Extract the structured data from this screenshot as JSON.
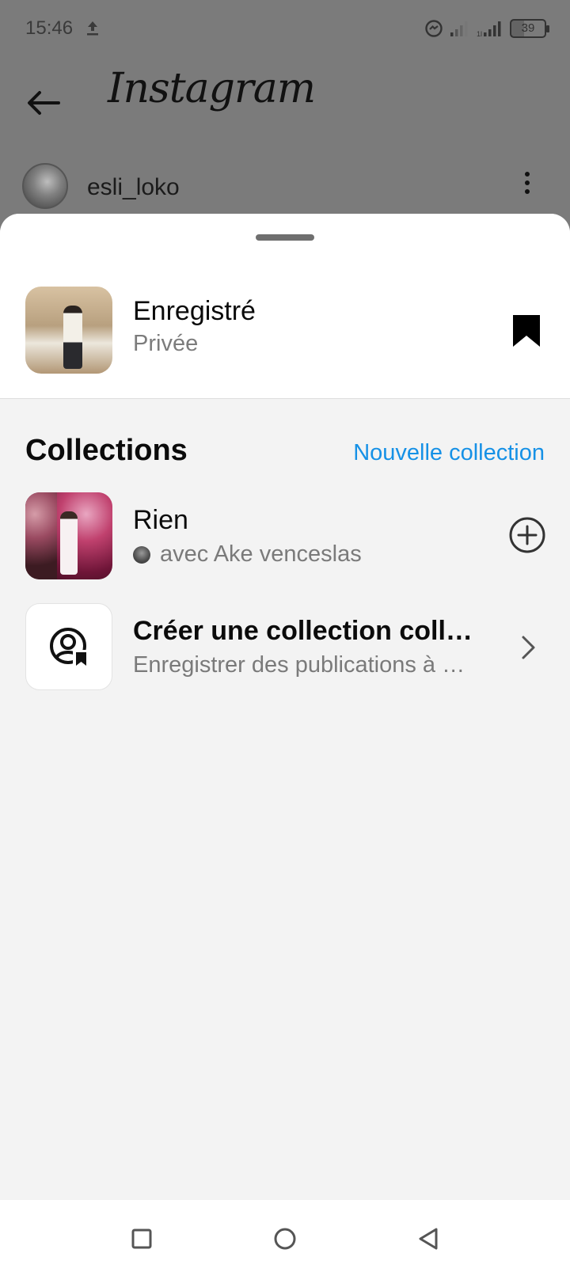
{
  "status_bar": {
    "time": "15:46",
    "battery": "39",
    "icons": [
      "upload-icon",
      "messenger-bubble-icon",
      "signal-icon",
      "signal-icon",
      "battery-icon"
    ]
  },
  "header": {
    "app_name": "Instagram",
    "back_icon": "arrow-left-icon"
  },
  "post": {
    "username": "esli_loko",
    "more_icon": "vertical-dots-icon"
  },
  "sheet": {
    "saved": {
      "title": "Enregistré",
      "privacy": "Privée",
      "icon": "bookmark-filled-icon"
    },
    "collections": {
      "title": "Collections",
      "new_collection_label": "Nouvelle collection",
      "items": [
        {
          "name": "Rien",
          "collaborators": "avec Ake venceslas",
          "action_icon": "plus-circle-icon"
        }
      ],
      "create": {
        "title": "Créer une collection colla…",
        "subtitle": "Enregistrer des publications à …",
        "icon": "collab-bookmark-icon"
      }
    }
  },
  "nav": {
    "icons": [
      "recent-apps-icon",
      "home-icon",
      "back-triangle-icon"
    ]
  },
  "colors": {
    "accent": "#1691e6",
    "sheet_bg": "#f3f3f3",
    "scrim": "#7b7b7b"
  }
}
